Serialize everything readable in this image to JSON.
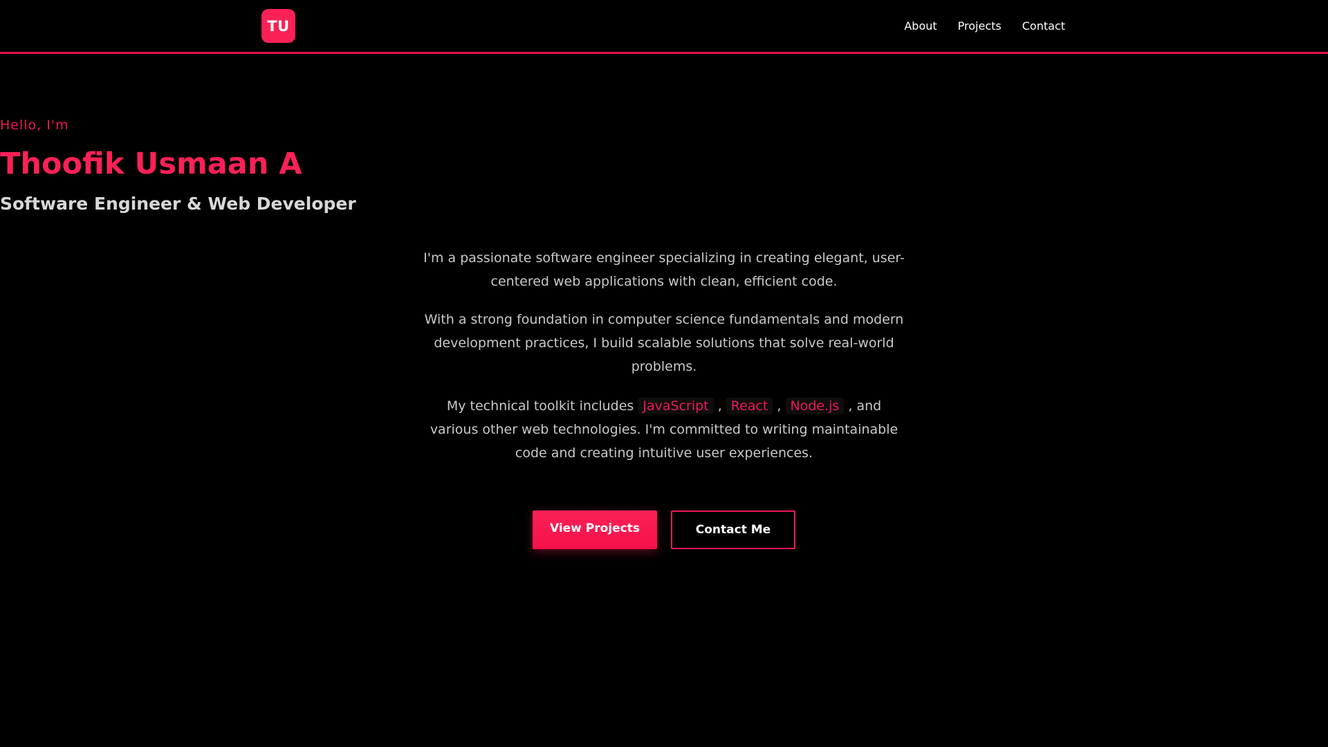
{
  "header": {
    "logo_text": "TU",
    "nav": {
      "about": "About",
      "projects": "Projects",
      "contact": "Contact"
    }
  },
  "hero": {
    "greeting": "Hello, I'm",
    "name": "Thoofik Usmaan A",
    "role": "Software Engineer & Web Developer",
    "bio1": "I'm a passionate software engineer specializing in creating elegant, user-centered web applications with clean, efficient code.",
    "bio2": "With a strong foundation in computer science fundamentals and modern development practices, I build scalable solutions that solve real-world problems.",
    "bio3": {
      "prefix": "My technical toolkit includes",
      "tech1": "JavaScript",
      "sep1": ",",
      "tech2": "React",
      "sep2": ",",
      "tech3": "Node.js",
      "suffix": ", and various other web technologies. I'm committed to writing maintainable code and creating intuitive user experiences."
    },
    "buttons": {
      "primary": "View Projects",
      "secondary": "Contact Me"
    }
  },
  "colors": {
    "background": "#000000",
    "accent": "#fb2157",
    "text": "#c9c9c9"
  }
}
